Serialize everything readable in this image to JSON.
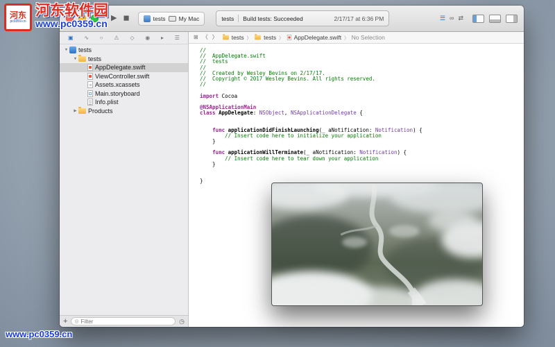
{
  "watermarks": {
    "logo_title": "河东软件园",
    "seal_glyph": "河东",
    "seal_sub": "pc0359.cn",
    "logo_url": "www.pc0359.cn",
    "bottom_url": "www.pc0359.cn"
  },
  "toolbar": {
    "scheme": "tests",
    "destination": "My Mac",
    "status_project": "tests",
    "status_message": "Build tests: Succeeded",
    "status_time": "2/17/17 at 6:36 PM"
  },
  "icons": {
    "run": "▶",
    "stop": "◼",
    "editor_standard": "☰",
    "editor_assistant": "∞",
    "editor_version": "⇄",
    "related_items": "⊞",
    "back": "〈",
    "forward": "〉",
    "crumb_separator": "〉",
    "add": "+",
    "filter": "◎",
    "clock": "◷",
    "disclosure_open": "▼",
    "disclosure_closed": "▶"
  },
  "nav_tabs": [
    {
      "name": "project-navigator",
      "glyph": "▣",
      "selected": true
    },
    {
      "name": "source-control-navigator",
      "glyph": "∿",
      "selected": false
    },
    {
      "name": "find-navigator",
      "glyph": "○",
      "selected": false
    },
    {
      "name": "issue-navigator",
      "glyph": "⚠",
      "selected": false
    },
    {
      "name": "test-navigator",
      "glyph": "◇",
      "selected": false
    },
    {
      "name": "debug-navigator",
      "glyph": "◉",
      "selected": false
    },
    {
      "name": "breakpoint-navigator",
      "glyph": "▸",
      "selected": false
    },
    {
      "name": "report-navigator",
      "glyph": "☰",
      "selected": false
    }
  ],
  "sidebar": {
    "filter_placeholder": "Filter",
    "tree": [
      {
        "label": "tests",
        "level": 0,
        "icon": "project",
        "disclosure": "open",
        "selected": false
      },
      {
        "label": "tests",
        "level": 1,
        "icon": "folder",
        "disclosure": "open",
        "selected": false
      },
      {
        "label": "AppDelegate.swift",
        "level": 2,
        "icon": "swift",
        "disclosure": null,
        "selected": true
      },
      {
        "label": "ViewController.swift",
        "level": 2,
        "icon": "swift",
        "disclosure": null,
        "selected": false
      },
      {
        "label": "Assets.xcassets",
        "level": 2,
        "icon": "assets",
        "disclosure": null,
        "selected": false
      },
      {
        "label": "Main.storyboard",
        "level": 2,
        "icon": "storyboard",
        "disclosure": null,
        "selected": false
      },
      {
        "label": "Info.plist",
        "level": 2,
        "icon": "plist",
        "disclosure": null,
        "selected": false
      },
      {
        "label": "Products",
        "level": 1,
        "icon": "folder",
        "disclosure": "closed",
        "selected": false
      }
    ]
  },
  "jumpbar": {
    "crumbs": [
      {
        "label": "tests",
        "icon": "folder"
      },
      {
        "label": "tests",
        "icon": "folder"
      },
      {
        "label": "AppDelegate.swift",
        "icon": "swift"
      },
      {
        "label": "No Selection",
        "icon": "none"
      }
    ]
  },
  "editor": {
    "code": [
      [
        {
          "s": "c",
          "t": "//"
        }
      ],
      [
        {
          "s": "c",
          "t": "//  AppDelegate.swift"
        }
      ],
      [
        {
          "s": "c",
          "t": "//  tests"
        }
      ],
      [
        {
          "s": "c",
          "t": "//"
        }
      ],
      [
        {
          "s": "c",
          "t": "//  Created by Wesley Bevins on 2/17/17."
        }
      ],
      [
        {
          "s": "c",
          "t": "//  Copyright © 2017 Wesley Bevins. All rights reserved."
        }
      ],
      [
        {
          "s": "c",
          "t": "//"
        }
      ],
      [],
      [
        {
          "s": "k",
          "t": "import"
        },
        {
          "s": "p",
          "t": " Cocoa"
        }
      ],
      [],
      [
        {
          "s": "k",
          "t": "@NSApplicationMain"
        }
      ],
      [
        {
          "s": "k",
          "t": "class"
        },
        {
          "s": "p",
          "t": " "
        },
        {
          "s": "b",
          "t": "AppDelegate"
        },
        {
          "s": "p",
          "t": ": "
        },
        {
          "s": "t",
          "t": "NSObject"
        },
        {
          "s": "p",
          "t": ", "
        },
        {
          "s": "t",
          "t": "NSApplicationDelegate"
        },
        {
          "s": "p",
          "t": " {"
        }
      ],
      [],
      [],
      [
        {
          "s": "p",
          "t": "    "
        },
        {
          "s": "k",
          "t": "func"
        },
        {
          "s": "p",
          "t": " "
        },
        {
          "s": "b",
          "t": "applicationDidFinishLaunching"
        },
        {
          "s": "p",
          "t": "(_ aNotification: "
        },
        {
          "s": "t",
          "t": "Notification"
        },
        {
          "s": "p",
          "t": ") {"
        }
      ],
      [
        {
          "s": "c",
          "t": "        // Insert code here to initialize your application"
        }
      ],
      [
        {
          "s": "p",
          "t": "    }"
        }
      ],
      [],
      [
        {
          "s": "p",
          "t": "    "
        },
        {
          "s": "k",
          "t": "func"
        },
        {
          "s": "p",
          "t": " "
        },
        {
          "s": "b",
          "t": "applicationWillTerminate"
        },
        {
          "s": "p",
          "t": "(_ aNotification: "
        },
        {
          "s": "t",
          "t": "Notification"
        },
        {
          "s": "p",
          "t": ") {"
        }
      ],
      [
        {
          "s": "c",
          "t": "        // Insert code here to tear down your application"
        }
      ],
      [
        {
          "s": "p",
          "t": "    }"
        }
      ],
      [],
      [],
      [
        {
          "s": "p",
          "t": "}"
        }
      ]
    ]
  }
}
